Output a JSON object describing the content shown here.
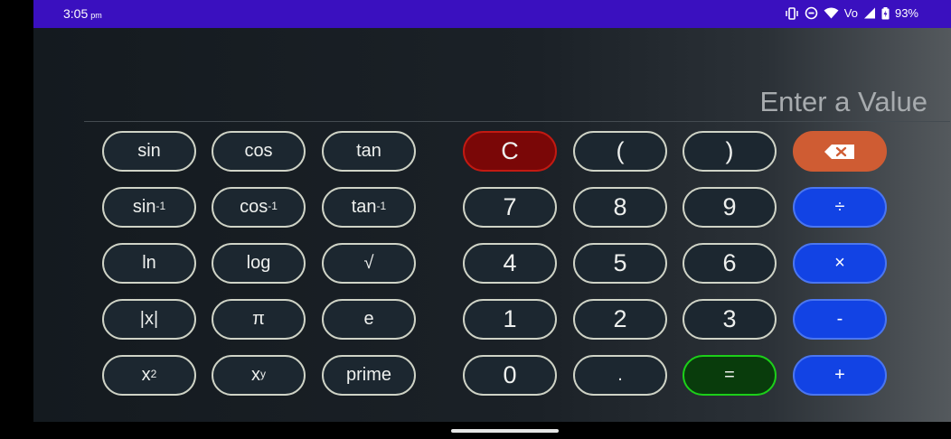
{
  "status_bar": {
    "time": "3:05",
    "ampm": "pm",
    "network_label": "Vo",
    "battery_percent": "93%"
  },
  "display": {
    "placeholder": "Enter a Value"
  },
  "keys": {
    "sin": "sin",
    "cos": "cos",
    "tan": "tan",
    "asin": "sin",
    "acos": "cos",
    "atan": "tan",
    "inverse_exp": "-1",
    "ln": "ln",
    "log": "log",
    "sqrt": "√",
    "abs": "|x|",
    "pi": "π",
    "e": "e",
    "square_base": "x",
    "square_exp": "2",
    "power_base": "x",
    "power_exp": "y",
    "prime": "prime",
    "clear": "C",
    "open_paren": "(",
    "close_paren": ")",
    "d7": "7",
    "d8": "8",
    "d9": "9",
    "divide": "÷",
    "d4": "4",
    "d5": "5",
    "d6": "6",
    "multiply": "×",
    "d1": "1",
    "d2": "2",
    "d3": "3",
    "minus": "-",
    "d0": "0",
    "dot": ".",
    "equals": "=",
    "plus": "+"
  },
  "icons": {
    "backspace": "backspace-icon",
    "status": [
      "vibrate-icon",
      "dnd-icon",
      "wifi-icon",
      "signal-icon",
      "battery-icon"
    ]
  },
  "colors": {
    "status_bar": "#3a10bf",
    "clear": "#7a0707",
    "backspace": "#cf5c33",
    "operator": "#1243e4",
    "equals": "#093c0c",
    "key": "#1c2730"
  }
}
